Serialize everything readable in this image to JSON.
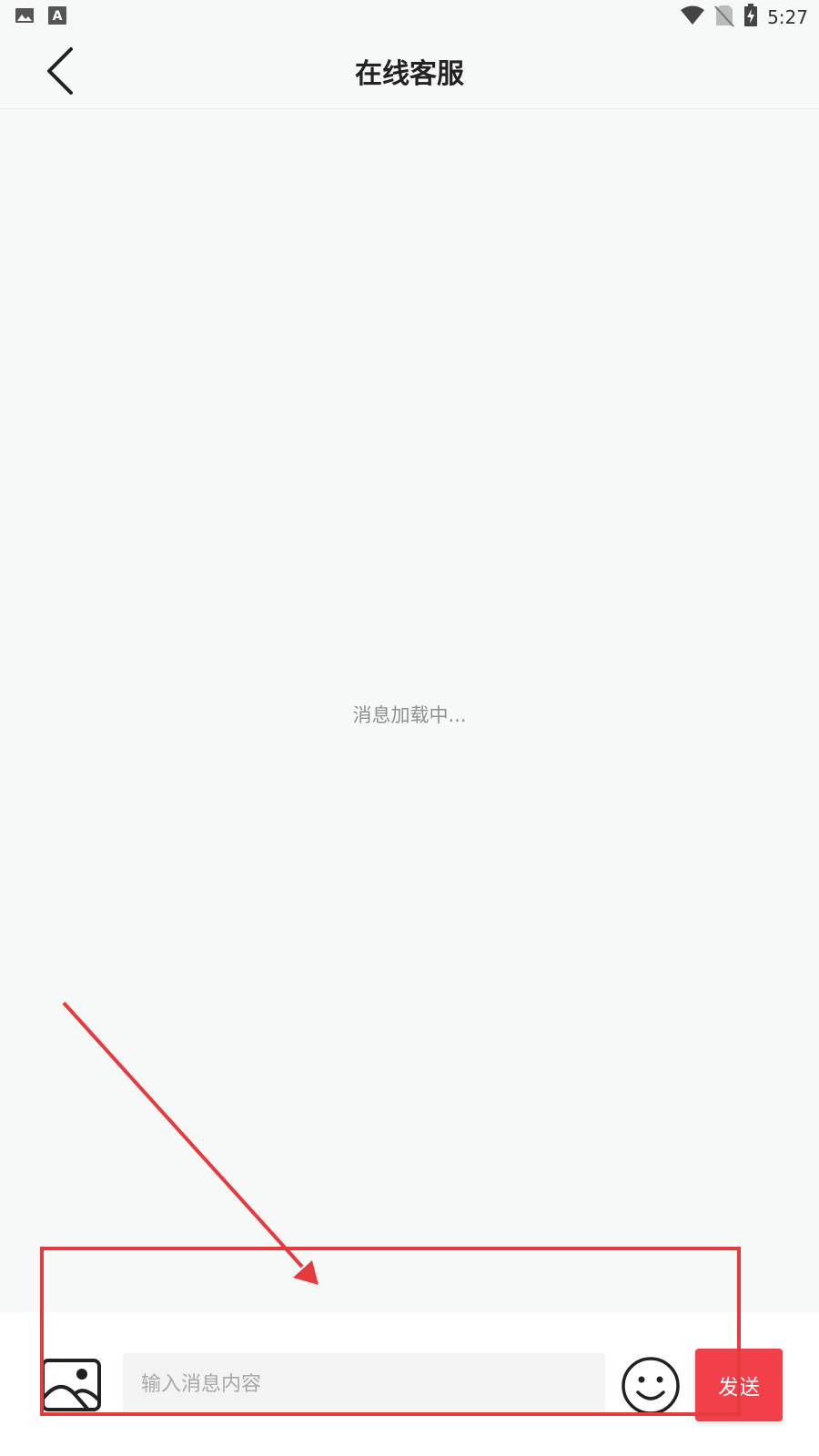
{
  "status_bar": {
    "time": "5:27",
    "left_icons": [
      "image-icon",
      "font-icon"
    ],
    "right_icons": [
      "wifi-icon",
      "no-sim-icon",
      "battery-charging-icon"
    ]
  },
  "header": {
    "title": "在线客服",
    "back_icon": "chevron-left-icon"
  },
  "messages": {
    "loading_text": "消息加载中..."
  },
  "input_bar": {
    "image_icon": "image-icon",
    "placeholder": "输入消息内容",
    "value": "",
    "emoji_icon": "smiley-icon",
    "send_label": "发送",
    "send_color": "#f2404a"
  },
  "annotation": {
    "color": "#e53b3f"
  }
}
